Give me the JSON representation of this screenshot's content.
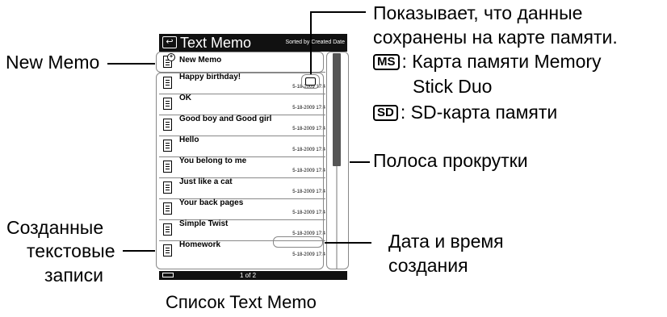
{
  "screen": {
    "title": "Text Memo",
    "sort_label": "Sorted by Created Date",
    "new_memo": "New Memo",
    "memos": [
      {
        "title": "Happy birthday!",
        "date": "5-18-2009 17:4"
      },
      {
        "title": "OK",
        "date": "5-18-2009 17:4"
      },
      {
        "title": "Good boy and Good girl",
        "date": "5-18-2009 17:4"
      },
      {
        "title": "Hello",
        "date": "5-18-2009 17:4"
      },
      {
        "title": "You belong to me",
        "date": "5-18-2009 17:4"
      },
      {
        "title": "Just like a cat",
        "date": "5-18-2009 17:4"
      },
      {
        "title": "Your back pages",
        "date": "5-18-2009 17:4"
      },
      {
        "title": "Simple Twist",
        "date": "5-18-2009 17:4"
      },
      {
        "title": "Homework",
        "date": "5-18-2009 17:4"
      }
    ],
    "page_indicator": "1 of 2"
  },
  "callouts": {
    "new_memo": "New Memo",
    "storage_line1": "Показывает, что данные",
    "storage_line2": "сохранены на карте памяти.",
    "ms_badge": "MS",
    "ms_line1": ": Карта памяти Memory",
    "ms_line2": "Stick Duo",
    "sd_badge": "SD",
    "sd_line": ": SD-карта памяти",
    "scrollbar": "Полоса прокрутки",
    "created_line1": "Созданные",
    "created_line2": "текстовые",
    "created_line3": "записи",
    "datetime_line1": "Дата и время",
    "datetime_line2": "создания"
  },
  "caption": "Список Text Memo",
  "icons": [
    "back-icon",
    "document-icon",
    "new-document-icon",
    "memory-card-icon",
    "battery-icon"
  ]
}
